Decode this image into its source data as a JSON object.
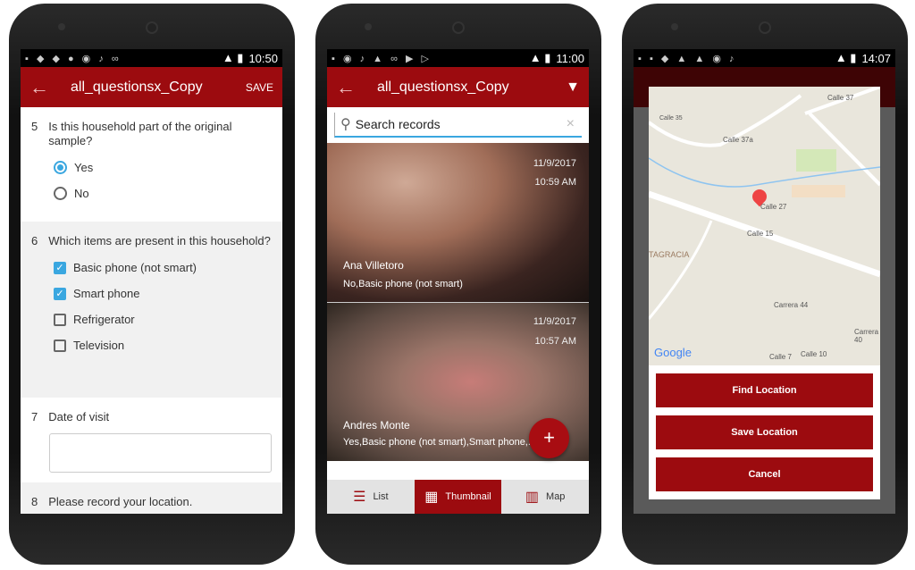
{
  "phone1": {
    "time": "10:50",
    "title": "all_questionsx_Copy",
    "save": "SAVE",
    "q5": {
      "num": "5",
      "text": "Is this household part of the original sample?",
      "options": [
        {
          "label": "Yes",
          "selected": true
        },
        {
          "label": "No",
          "selected": false
        }
      ]
    },
    "q6": {
      "num": "6",
      "text": "Which items are present in this household?",
      "options": [
        {
          "label": "Basic phone (not smart)",
          "checked": true
        },
        {
          "label": "Smart phone",
          "checked": true
        },
        {
          "label": "Refrigerator",
          "checked": false
        },
        {
          "label": "Television",
          "checked": false
        }
      ]
    },
    "q7": {
      "num": "7",
      "text": "Date of visit",
      "value": ""
    },
    "q8": {
      "num": "8",
      "text": "Please record your location."
    }
  },
  "phone2": {
    "time": "11:00",
    "title": "all_questionsx_Copy",
    "search_placeholder": "Search records",
    "records": [
      {
        "date": "11/9/2017",
        "time": "10:59 AM",
        "name": "Ana Villetoro",
        "summary": "No,Basic phone (not smart)"
      },
      {
        "date": "11/9/2017",
        "time": "10:57 AM",
        "name": "Andres Monte",
        "summary": "Yes,Basic phone (not smart),Smart phone,..."
      }
    ],
    "fab": "+",
    "tabs": [
      {
        "label": "List",
        "icon": "list-icon",
        "active": false
      },
      {
        "label": "Thumbnail",
        "icon": "grid-icon",
        "active": true
      },
      {
        "label": "Map",
        "icon": "map-icon",
        "active": false
      }
    ]
  },
  "phone3": {
    "time": "14:07",
    "map_labels": [
      "Calle 37",
      "Calle 35",
      "Calle 37a",
      "Calle 27",
      "Calle 15",
      "TAGRACIA",
      "Carrera 44",
      "Carrera 40",
      "Calle 7",
      "Calle 10"
    ],
    "map_brand": "Google",
    "buttons": [
      "Find Location",
      "Save Location",
      "Cancel"
    ]
  },
  "colors": {
    "accent": "#9c0b0f",
    "selection": "#3aa7e0"
  }
}
